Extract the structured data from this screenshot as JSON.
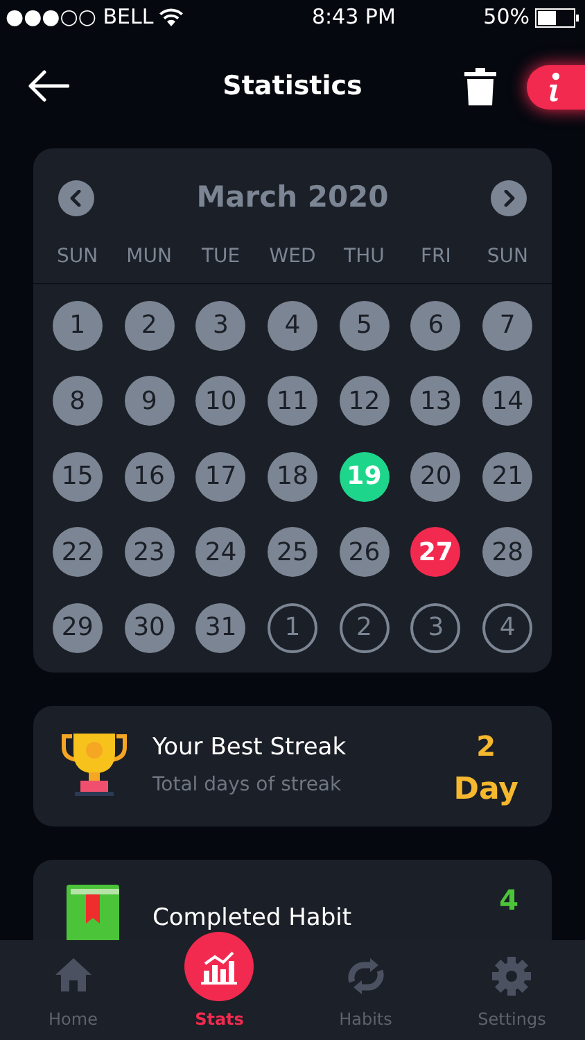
{
  "status_bar": {
    "carrier": "●●●○○ BELL",
    "time": "8:43 PM",
    "battery": "50%"
  },
  "header": {
    "title": "Statistics"
  },
  "calendar": {
    "month": "March 2020",
    "weekdays": [
      "SUN",
      "MUN",
      "TUE",
      "WED",
      "THU",
      "FRI",
      "SUN"
    ],
    "days": [
      {
        "label": "1",
        "kind": "past"
      },
      {
        "label": "2",
        "kind": "past"
      },
      {
        "label": "3",
        "kind": "past"
      },
      {
        "label": "4",
        "kind": "past"
      },
      {
        "label": "5",
        "kind": "past"
      },
      {
        "label": "6",
        "kind": "past"
      },
      {
        "label": "7",
        "kind": "past"
      },
      {
        "label": "8",
        "kind": "past"
      },
      {
        "label": "9",
        "kind": "past"
      },
      {
        "label": "10",
        "kind": "past"
      },
      {
        "label": "11",
        "kind": "past"
      },
      {
        "label": "12",
        "kind": "past"
      },
      {
        "label": "13",
        "kind": "past"
      },
      {
        "label": "14",
        "kind": "past"
      },
      {
        "label": "15",
        "kind": "past"
      },
      {
        "label": "16",
        "kind": "past"
      },
      {
        "label": "17",
        "kind": "past"
      },
      {
        "label": "18",
        "kind": "past"
      },
      {
        "label": "19",
        "kind": "done"
      },
      {
        "label": "20",
        "kind": "past"
      },
      {
        "label": "21",
        "kind": "past"
      },
      {
        "label": "22",
        "kind": "past"
      },
      {
        "label": "23",
        "kind": "past"
      },
      {
        "label": "24",
        "kind": "past"
      },
      {
        "label": "25",
        "kind": "past"
      },
      {
        "label": "26",
        "kind": "past"
      },
      {
        "label": "27",
        "kind": "missed"
      },
      {
        "label": "28",
        "kind": "past"
      },
      {
        "label": "29",
        "kind": "past"
      },
      {
        "label": "30",
        "kind": "past"
      },
      {
        "label": "31",
        "kind": "past"
      },
      {
        "label": "1",
        "kind": "other"
      },
      {
        "label": "2",
        "kind": "other"
      },
      {
        "label": "3",
        "kind": "other"
      },
      {
        "label": "4",
        "kind": "other"
      }
    ]
  },
  "stats": [
    {
      "kind": "trophy",
      "title": "Your Best Streak",
      "subtitle": "Total days of streak",
      "value": "2",
      "unit": "Day",
      "color": "#f5b82e"
    },
    {
      "kind": "book",
      "title": "Completed Habit",
      "value": "4",
      "color": "#4cc43a"
    }
  ],
  "tab_bar": [
    {
      "label": "Home",
      "kind": "home",
      "selected": false
    },
    {
      "label": "Stats",
      "kind": "chart",
      "selected": true
    },
    {
      "label": "Habits",
      "kind": "repeat",
      "selected": false
    },
    {
      "label": "Settings",
      "kind": "gear",
      "selected": false
    }
  ]
}
